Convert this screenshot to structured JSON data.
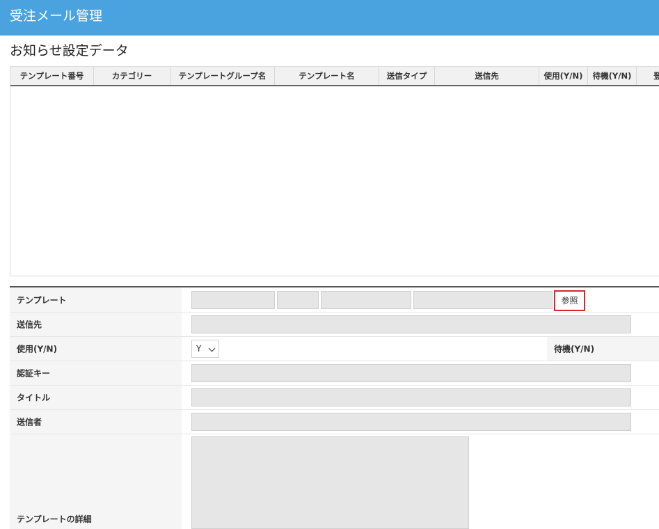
{
  "app": {
    "title": "受注メール管理"
  },
  "page": {
    "title": "お知らせ設定データ"
  },
  "grid": {
    "columns": [
      "テンプレート番号",
      "カテゴリー",
      "テンプレートグループ名",
      "テンプレート名",
      "送信タイプ",
      "送信先",
      "使用(Y/N)",
      "待機(Y/N)",
      "登"
    ],
    "rows": []
  },
  "form": {
    "template": {
      "label": "テンプレート",
      "fields": [
        "",
        "",
        "",
        ""
      ],
      "ref_button": "参照"
    },
    "recipient": {
      "label": "送信先",
      "value": ""
    },
    "use": {
      "label": "使用(Y/N)",
      "selected": "Y",
      "standby_label": "待機(Y/N)"
    },
    "auth_key": {
      "label": "認証キー",
      "value": ""
    },
    "title": {
      "label": "タイトル",
      "value": ""
    },
    "sender": {
      "label": "送信者",
      "value": ""
    },
    "details": {
      "label": "テンプレートの詳細",
      "value": ""
    }
  },
  "colors": {
    "header_bar": "#4aa3df",
    "ref_button_border": "#d9262c"
  }
}
